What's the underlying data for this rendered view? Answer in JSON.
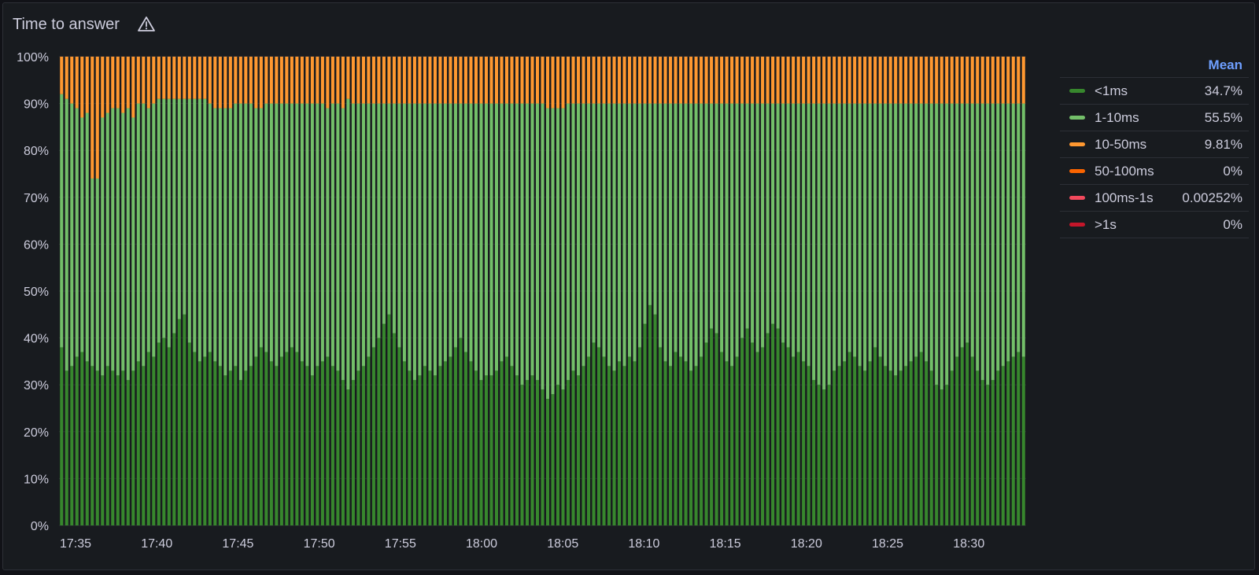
{
  "panel": {
    "title": "Time to answer",
    "warning_icon": "warning-triangle-icon"
  },
  "legend": {
    "stat_header": "Mean",
    "items": [
      {
        "name": "<1ms",
        "value": "34.7%",
        "color": "#37872d"
      },
      {
        "name": "1-10ms",
        "value": "55.5%",
        "color": "#73bf69"
      },
      {
        "name": "10-50ms",
        "value": "9.81%",
        "color": "#ff9830"
      },
      {
        "name": "50-100ms",
        "value": "0%",
        "color": "#fa6400"
      },
      {
        "name": "100ms-1s",
        "value": "0.00252%",
        "color": "#f2495c"
      },
      {
        "name": ">1s",
        "value": "0%",
        "color": "#c4162a"
      }
    ]
  },
  "chart_data": {
    "type": "bar",
    "stacking": "percent",
    "ylim": [
      0,
      100
    ],
    "y_ticks": [
      "0%",
      "10%",
      "20%",
      "30%",
      "40%",
      "50%",
      "60%",
      "70%",
      "80%",
      "90%",
      "100%"
    ],
    "x_ticks": [
      "17:35",
      "17:40",
      "17:45",
      "17:50",
      "17:55",
      "18:00",
      "18:05",
      "18:10",
      "18:15",
      "18:20",
      "18:25",
      "18:30"
    ],
    "grid": true,
    "legend_position": "right",
    "bar_width_fraction": 0.62,
    "series": [
      {
        "name": "<1ms",
        "color": "#37872d",
        "values": [
          38,
          33,
          34,
          36,
          37,
          35,
          34,
          33,
          32,
          34,
          33,
          32,
          33,
          31,
          33,
          35,
          34,
          37,
          36,
          39,
          40,
          38,
          41,
          44,
          45,
          39,
          37,
          35,
          36,
          37,
          35,
          34,
          32,
          33,
          34,
          31,
          33,
          34,
          36,
          38,
          37,
          35,
          34,
          36,
          37,
          38,
          37,
          35,
          34,
          32,
          34,
          35,
          36,
          34,
          33,
          31,
          29,
          31,
          33,
          34,
          36,
          38,
          40,
          43,
          45,
          41,
          38,
          35,
          33,
          31,
          32,
          34,
          33,
          32,
          34,
          35,
          36,
          38,
          40,
          37,
          35,
          33,
          31,
          32,
          32,
          33,
          35,
          36,
          34,
          32,
          30,
          31,
          32,
          31,
          29,
          27,
          28,
          30,
          29,
          31,
          33,
          32,
          34,
          36,
          39,
          38,
          36,
          34,
          33,
          35,
          34,
          36,
          35,
          38,
          43,
          47,
          45,
          38,
          35,
          34,
          37,
          36,
          35,
          33,
          34,
          36,
          39,
          42,
          41,
          37,
          35,
          34,
          36,
          40,
          42,
          39,
          37,
          38,
          41,
          43,
          42,
          39,
          38,
          36,
          37,
          35,
          34,
          31,
          30,
          29,
          30,
          33,
          34,
          35,
          37,
          36,
          34,
          33,
          35,
          38,
          36,
          34,
          33,
          32,
          33,
          34,
          35,
          36,
          37,
          35,
          33,
          30,
          29,
          30,
          33,
          36,
          38,
          39,
          36,
          33,
          31,
          30,
          31,
          33,
          34,
          35,
          36,
          37,
          36
        ],
        "_note": "fractions of 100% per time bucket (approx.)"
      },
      {
        "name": "1-10ms",
        "color": "#73bf69",
        "values": [
          54,
          58,
          56,
          53,
          50,
          53,
          40,
          41,
          55,
          54,
          56,
          57,
          55,
          58,
          54,
          55,
          56,
          52,
          54,
          52,
          51,
          53,
          50,
          47,
          46,
          52,
          54,
          56,
          55,
          53,
          54,
          55,
          57,
          56,
          56,
          59,
          57,
          56,
          53,
          51,
          53,
          55,
          56,
          54,
          53,
          52,
          53,
          55,
          56,
          58,
          56,
          55,
          53,
          56,
          57,
          58,
          62,
          59,
          57,
          56,
          54,
          52,
          50,
          47,
          45,
          49,
          52,
          55,
          57,
          59,
          58,
          56,
          57,
          58,
          56,
          55,
          54,
          52,
          50,
          53,
          55,
          57,
          59,
          58,
          58,
          57,
          55,
          54,
          56,
          58,
          60,
          59,
          58,
          59,
          61,
          62,
          61,
          59,
          60,
          59,
          57,
          58,
          56,
          54,
          51,
          52,
          54,
          56,
          57,
          55,
          56,
          54,
          55,
          52,
          47,
          43,
          45,
          52,
          55,
          56,
          53,
          54,
          55,
          57,
          56,
          54,
          51,
          48,
          49,
          53,
          55,
          56,
          54,
          50,
          48,
          51,
          53,
          52,
          49,
          47,
          48,
          51,
          52,
          54,
          53,
          55,
          56,
          59,
          60,
          61,
          60,
          57,
          56,
          55,
          53,
          54,
          56,
          57,
          55,
          52,
          54,
          56,
          57,
          58,
          57,
          56,
          55,
          54,
          53,
          55,
          57,
          60,
          61,
          60,
          57,
          54,
          52,
          51,
          54,
          57,
          59,
          60,
          59,
          57,
          56,
          55,
          54,
          53,
          54
        ],
        "_note": "fractions of 100% per time bucket (approx.)"
      },
      {
        "name": "10-50ms",
        "color": "#ff9830",
        "values": [
          8,
          9,
          10,
          11,
          13,
          12,
          26,
          26,
          13,
          12,
          11,
          11,
          12,
          11,
          13,
          10,
          10,
          11,
          10,
          9,
          9,
          9,
          9,
          9,
          9,
          9,
          9,
          9,
          9,
          10,
          11,
          11,
          11,
          11,
          10,
          10,
          10,
          10,
          11,
          11,
          10,
          10,
          10,
          10,
          10,
          10,
          10,
          10,
          10,
          10,
          10,
          10,
          11,
          10,
          10,
          11,
          9,
          10,
          10,
          10,
          10,
          10,
          10,
          10,
          10,
          10,
          10,
          10,
          10,
          10,
          10,
          10,
          10,
          10,
          10,
          10,
          10,
          10,
          10,
          10,
          10,
          10,
          10,
          10,
          10,
          10,
          10,
          10,
          10,
          10,
          10,
          10,
          10,
          10,
          10,
          11,
          11,
          11,
          11,
          10,
          10,
          10,
          10,
          10,
          10,
          10,
          10,
          10,
          10,
          10,
          10,
          10,
          10,
          10,
          10,
          10,
          10,
          10,
          10,
          10,
          10,
          10,
          10,
          10,
          10,
          10,
          10,
          10,
          10,
          10,
          10,
          10,
          10,
          10,
          10,
          10,
          10,
          10,
          10,
          10,
          10,
          10,
          10,
          10,
          10,
          10,
          10,
          10,
          10,
          10,
          10,
          10,
          10,
          10,
          10,
          10,
          10,
          10,
          10,
          10,
          10,
          10,
          10,
          10,
          10,
          10,
          10,
          10,
          10,
          10,
          10,
          10,
          10,
          10,
          10,
          10,
          10,
          10,
          10,
          10,
          10,
          10,
          10,
          10,
          10,
          10,
          10,
          10,
          10
        ],
        "_note": "fractions of 100% per time bucket (approx.)"
      }
    ]
  }
}
